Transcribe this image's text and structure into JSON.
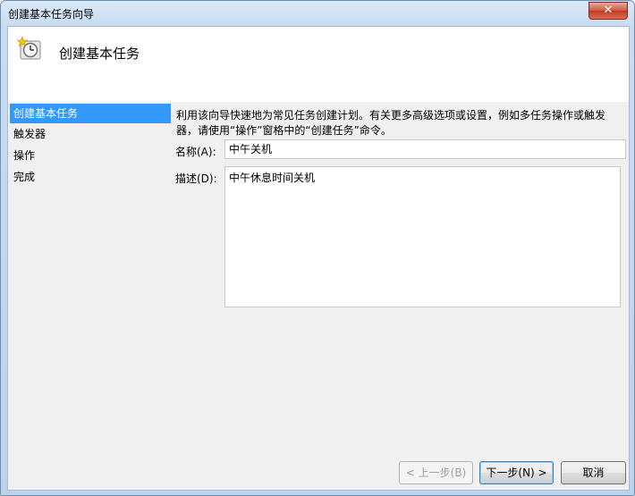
{
  "window": {
    "title": "创建基本任务向导",
    "close_label": "✕"
  },
  "header": {
    "title": "创建基本任务",
    "icon": "clock-icon"
  },
  "nav": {
    "items": [
      {
        "label": "创建基本任务",
        "active": true
      },
      {
        "label": "触发器",
        "active": false
      },
      {
        "label": "操作",
        "active": false
      },
      {
        "label": "完成",
        "active": false
      }
    ]
  },
  "main": {
    "description": "利用该向导快速地为常见任务创建计划。有关更多高级选项或设置，例如多任务操作或触发器，请使用“操作”窗格中的“创建任务”命令。",
    "name_label": "名称(A):",
    "name_value": "中午关机",
    "desc_label": "描述(D):",
    "desc_value": "中午休息时间关机"
  },
  "buttons": {
    "back": "< 上一步(B)",
    "next": "下一步(N) >",
    "cancel": "取消"
  }
}
